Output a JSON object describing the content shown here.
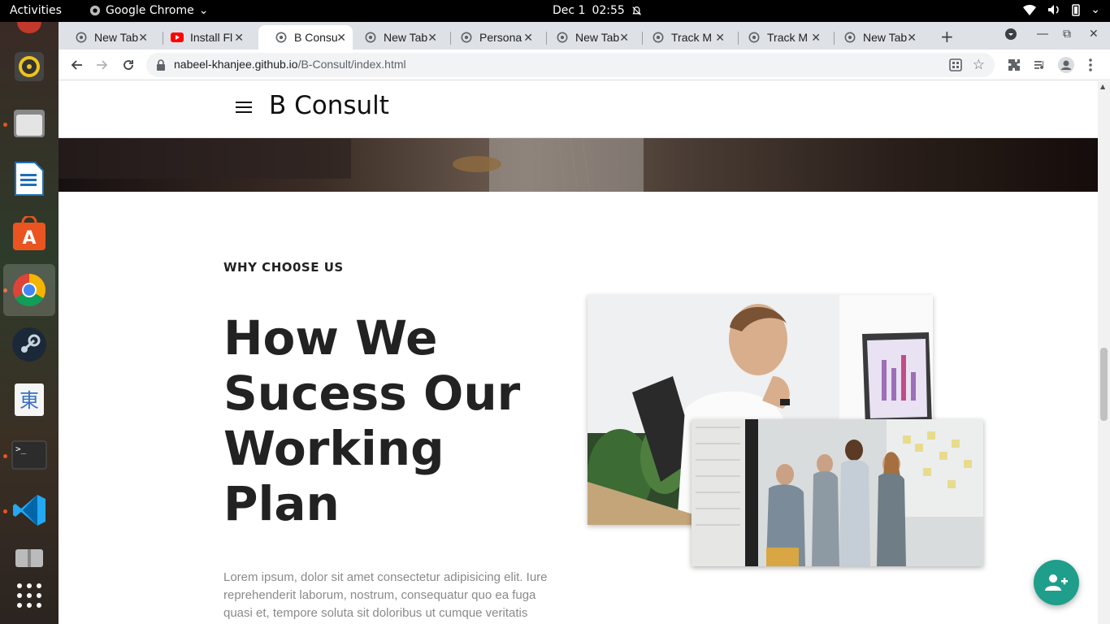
{
  "topbar": {
    "activities": "Activities",
    "app_name": "Google Chrome",
    "date": "Dec 1",
    "time": "02:55"
  },
  "dock": {
    "items": [
      "rhythmbox-icon",
      "files-icon",
      "writer-icon",
      "app-center-icon",
      "chrome-icon",
      "steam-icon",
      "mozc-icon",
      "terminal-icon",
      "vscode-icon",
      "archive-icon",
      "show-apps-icon"
    ]
  },
  "browser": {
    "tabs": [
      {
        "title": "New Tab"
      },
      {
        "title": "Install Fl"
      },
      {
        "title": "B Consu"
      },
      {
        "title": "New Tab"
      },
      {
        "title": "Persona"
      },
      {
        "title": "New Tab"
      },
      {
        "title": "Track M"
      },
      {
        "title": "Track M"
      },
      {
        "title": "New Tab"
      }
    ],
    "url_host": "nabeel-khanjee.github.io",
    "url_path": "/B-Consult/index.html"
  },
  "page": {
    "brand": "B Consult",
    "eyebrow": "WHY CHO0SE US",
    "headline": "How We Sucess Our Working Plan",
    "lorem": "Lorem ipsum, dolor sit amet consectetur adipisicing elit. Iure reprehenderit laborum, nostrum, consequatur quo ea fuga quasi et, tempore soluta sit doloribus ut cumque veritatis"
  },
  "colors": {
    "fab": "#1f9e8c",
    "ubuntu_orange": "#e95420"
  }
}
